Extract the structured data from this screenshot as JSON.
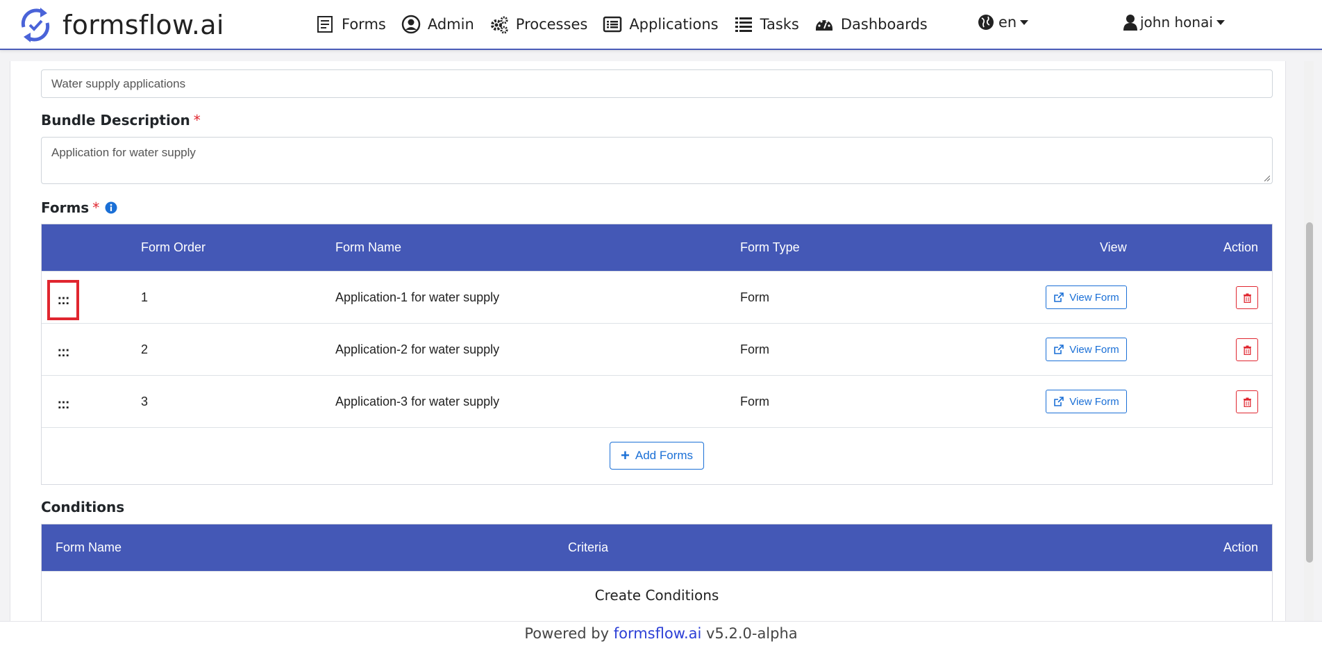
{
  "brand": {
    "name": "formsflow.ai"
  },
  "nav": {
    "items": [
      {
        "label": "Forms",
        "icon": "form-icon"
      },
      {
        "label": "Admin",
        "icon": "user-circle-icon"
      },
      {
        "label": "Processes",
        "icon": "gears-icon"
      },
      {
        "label": "Applications",
        "icon": "list-alt-icon"
      },
      {
        "label": "Tasks",
        "icon": "list-icon"
      },
      {
        "label": "Dashboards",
        "icon": "dashboard-icon"
      }
    ],
    "language": "en",
    "user": "john honai"
  },
  "bundle": {
    "name_value": "Water supply applications",
    "description_label": "Bundle Description",
    "description_value": "Application for water supply",
    "required_mark": "*"
  },
  "forms_section": {
    "label": "Forms",
    "headers": {
      "order": "Form Order",
      "name": "Form Name",
      "type": "Form Type",
      "view": "View",
      "action": "Action"
    },
    "rows": [
      {
        "handle": ":::",
        "order": "1",
        "name": "Application-1 for water supply",
        "type": "Form",
        "view_label": "View Form"
      },
      {
        "handle": ":::",
        "order": "2",
        "name": "Application-2 for water supply",
        "type": "Form",
        "view_label": "View Form"
      },
      {
        "handle": ":::",
        "order": "3",
        "name": "Application-3 for water supply",
        "type": "Form",
        "view_label": "View Form"
      }
    ],
    "add_label": "Add Forms"
  },
  "conditions_section": {
    "label": "Conditions",
    "headers": {
      "name": "Form Name",
      "criteria": "Criteria",
      "action": "Action"
    },
    "create_label": "Create Conditions"
  },
  "footer": {
    "prefix": "Powered by ",
    "link": "formsflow.ai",
    "version": " v5.2.0-alpha"
  },
  "colors": {
    "primary": "#4458b6",
    "link": "#1a6fd6",
    "danger": "#e0262f"
  }
}
